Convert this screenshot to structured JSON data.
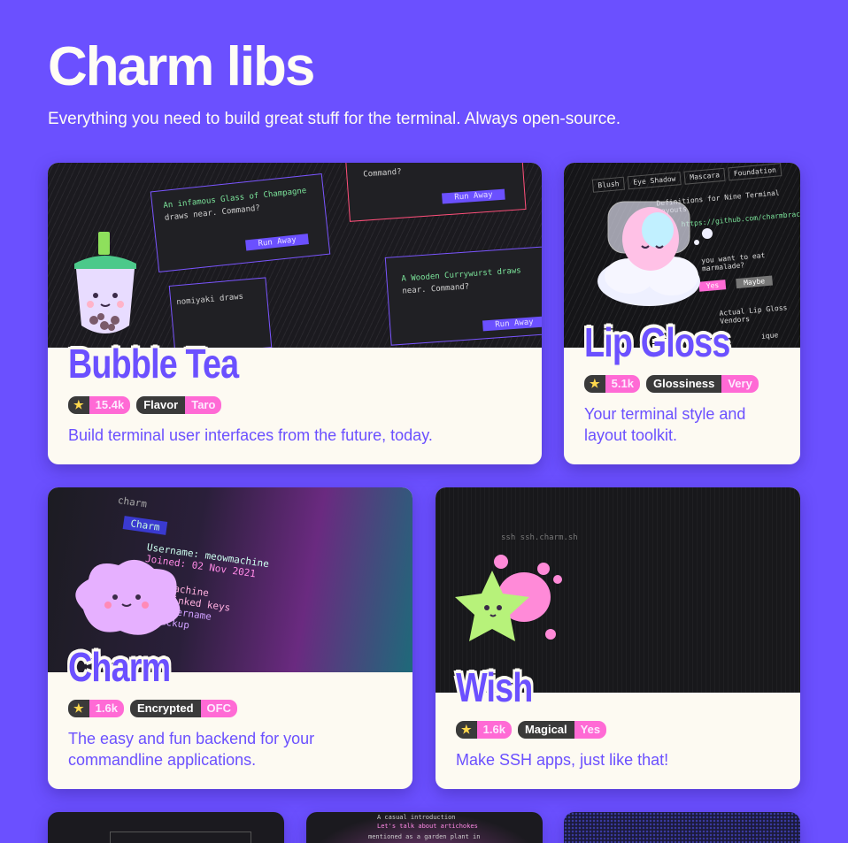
{
  "header": {
    "title": "Charm libs",
    "subtitle": "Everything you need to build great stuff for the terminal. Always open-source."
  },
  "cards": [
    {
      "name": "Bubble Tea",
      "stars": "15.4k",
      "badge_key": "Flavor",
      "badge_value": "Taro",
      "description": "Build terminal user interfaces from the future, today.",
      "art": {
        "line1": "Command?",
        "line2": "An infamous Glass of Champagne",
        "line3": "draws near. Command?",
        "line4": "Run Away",
        "line5": "A Wooden Currywurst draws",
        "line6": "near. Command?",
        "line7": "nomiyaki draws"
      }
    },
    {
      "name": "Lip Gloss",
      "stars": "5.1k",
      "badge_key": "Glossiness",
      "badge_value": "Very",
      "description_line1": "Your terminal style and",
      "description_line2": "layout toolkit.",
      "art": {
        "tab1": "Blush",
        "tab2": "Eye Shadow",
        "tab3": "Mascara",
        "tab4": "Foundation",
        "line1": "Definitions for Nine Terminal Layouts",
        "line2": "https://github.com/charmbracelet/",
        "line3": "you want to eat marmalade?",
        "btn1": "Yes",
        "btn2": "Maybe",
        "line4": "Actual Lip Gloss Vendors",
        "line5": "ique"
      }
    },
    {
      "name": "Charm",
      "stars": "1.6k",
      "badge_key": "Encrypted",
      "badge_value": "OFC",
      "description_line1": "The easy and fun backend for your",
      "description_line2": "commandline applications.",
      "art": {
        "line1": "charm",
        "line2": "Charm",
        "line3": "Username: meowmachine",
        "line4": "Joined: 02 Nov 2021",
        "line5": "machine",
        "line6": "linked keys",
        "line7": "Username",
        "line8": "Backup"
      }
    },
    {
      "name": "Wish",
      "stars": "1.6k",
      "badge_key": "Magical",
      "badge_value": "Yes",
      "description": "Make SSH apps, just like that!",
      "art": {
        "line1": "ssh ssh.charm.sh"
      }
    }
  ],
  "bottom_cards": {
    "b2_line1": "A casual introduction",
    "b2_line2": "Let's talk about artichokes",
    "b2_line3": "mentioned as a garden plant in"
  },
  "icons": {
    "star": "★"
  },
  "colors": {
    "accent": "#6b50ff",
    "pink": "#ff6ad5",
    "card_bg": "#fdfaf2",
    "badge_dark": "#3a3a3a"
  }
}
